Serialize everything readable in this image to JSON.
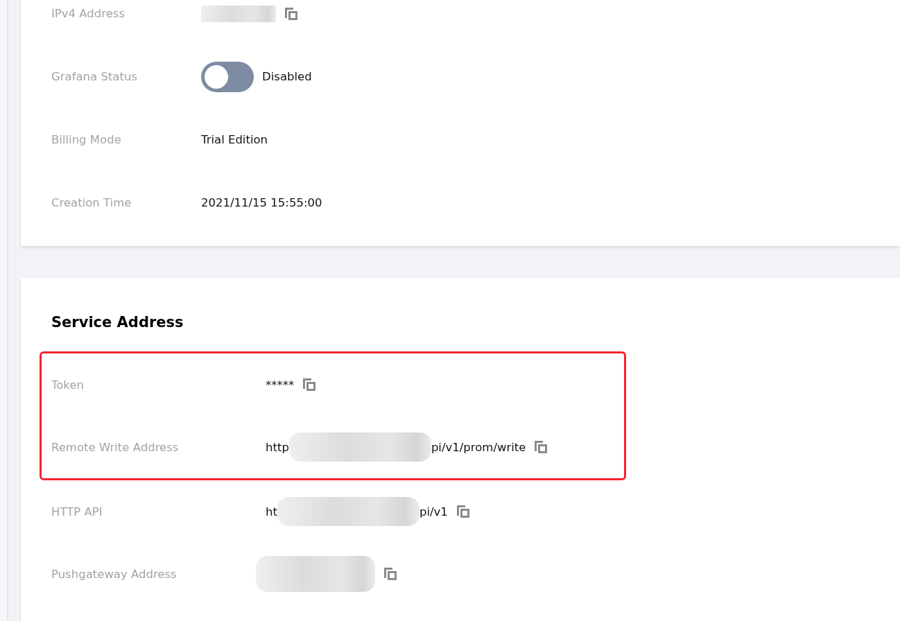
{
  "basic_info": {
    "rows": [
      {
        "label": "IPv4 Address",
        "kind": "redacted",
        "copyable": true
      },
      {
        "label": "Grafana Status",
        "kind": "toggle",
        "on": false,
        "text": "Disabled",
        "copyable": false
      },
      {
        "label": "Billing Mode",
        "kind": "text",
        "text": "Trial Edition",
        "copyable": false
      },
      {
        "label": "Creation Time",
        "kind": "text",
        "text": "2021/11/15 15:55:00",
        "copyable": false
      }
    ]
  },
  "service_address": {
    "title": "Service Address",
    "groups": [
      {
        "highlighted": true,
        "rows": [
          {
            "label": "Token",
            "kind": "text",
            "text": "*****",
            "copyable": true
          },
          {
            "label": "Remote Write Address",
            "kind": "partial",
            "prefix": "http",
            "suffix": "pi/v1/prom/write",
            "copyable": true
          }
        ]
      },
      {
        "highlighted": false,
        "rows": [
          {
            "label": "HTTP API",
            "kind": "partial",
            "prefix": "ht",
            "suffix": "pi/v1",
            "copyable": true
          },
          {
            "label": "Pushgateway Address",
            "kind": "redacted",
            "copyable": true
          }
        ]
      }
    ]
  }
}
